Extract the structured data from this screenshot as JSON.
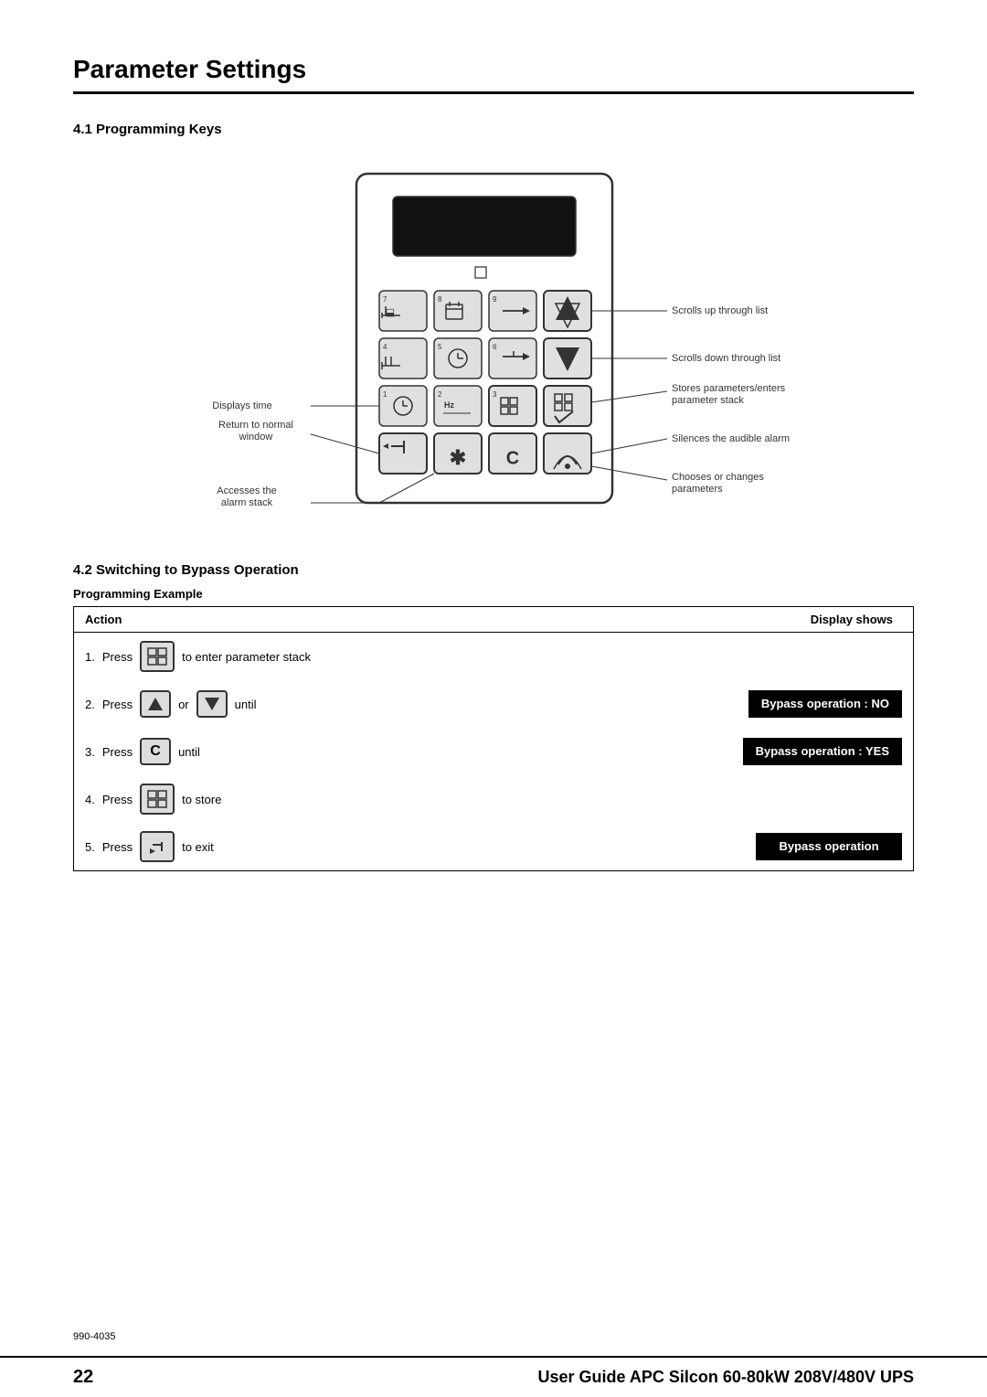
{
  "page": {
    "title": "Parameter Settings",
    "doc_number": "990-4035",
    "footer_page": "22",
    "footer_title": "User Guide APC Silcon 60-80kW 208V/480V UPS"
  },
  "section41": {
    "heading": "4.1   Programming Keys"
  },
  "annotations": {
    "displays_time": "Displays time",
    "return_normal": "Return to normal\nwindow",
    "accesses_alarm": "Accesses the\nalarm stack",
    "scrolls_up": "Scrolls up through list",
    "scrolls_down": "Scrolls down through list",
    "stores_parameters": "Stores parameters/enters\nparameter stack",
    "silences_alarm": "Silences the audible alarm",
    "chooses_changes": "Chooses or changes\nparameters"
  },
  "section42": {
    "heading": "4.2   Switching to Bypass Operation",
    "subheading": "Programming Example"
  },
  "table": {
    "header_action": "Action",
    "header_display": "Display shows",
    "rows": [
      {
        "number": "1.",
        "press_label": "Press",
        "key_type": "grid",
        "text_after": "to enter parameter stack",
        "display": null
      },
      {
        "number": "2.",
        "press_label": "Press",
        "key_type": "up",
        "or_label": "or",
        "key_type2": "down",
        "text_after": "until",
        "display": "Bypass operation\n: NO"
      },
      {
        "number": "3.",
        "press_label": "Press",
        "key_type": "c",
        "text_after": "until",
        "display": "Bypass operation\n: YES"
      },
      {
        "number": "4.",
        "press_label": "Press",
        "key_type": "grid",
        "text_after": "to store",
        "display": null
      },
      {
        "number": "5.",
        "press_label": "Press",
        "key_type": "enter",
        "text_after": "to exit",
        "display": "Bypass operation"
      }
    ]
  }
}
